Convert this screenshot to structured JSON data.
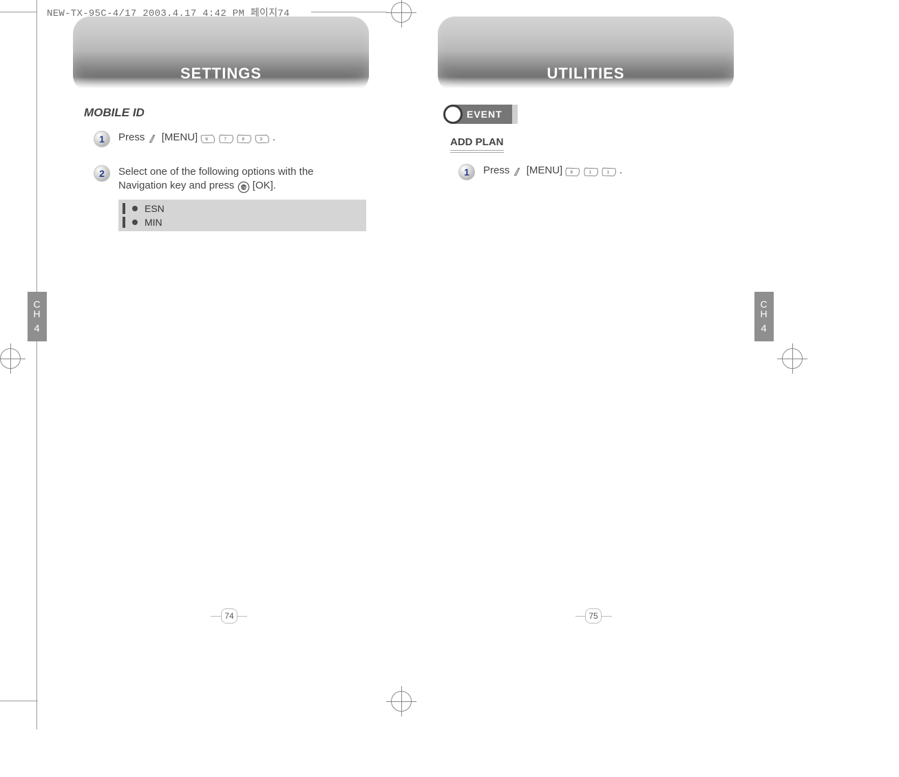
{
  "print_header": "NEW-TX-95C-4/17  2003.4.17 4:42 PM  페이지74",
  "left_page": {
    "title": "SETTINGS",
    "chapter_tab": {
      "label": "CH",
      "number": "4"
    },
    "section_heading": "MOBILE ID",
    "steps": {
      "s1": {
        "num": "1",
        "prefix": "Press ",
        "menu": "[MENU]",
        "keys": [
          "6",
          "7",
          "8",
          "3"
        ],
        "suffix": "."
      },
      "s2": {
        "num": "2",
        "line1": "Select one of the following options with the",
        "line2_pre": "Navigation key and press ",
        "ok_label": "[OK]",
        "line2_post": "."
      }
    },
    "info_items": [
      "ESN",
      "MIN"
    ],
    "page_number": "74"
  },
  "right_page": {
    "title": "UTILITIES",
    "chapter_tab": {
      "label": "CH",
      "number": "4"
    },
    "event_label": "EVENT",
    "sub_heading": "ADD PLAN",
    "steps": {
      "s1": {
        "num": "1",
        "prefix": "Press ",
        "menu": "[MENU]",
        "keys": [
          "8",
          "1",
          "1"
        ],
        "suffix": "."
      }
    },
    "page_number": "75"
  }
}
